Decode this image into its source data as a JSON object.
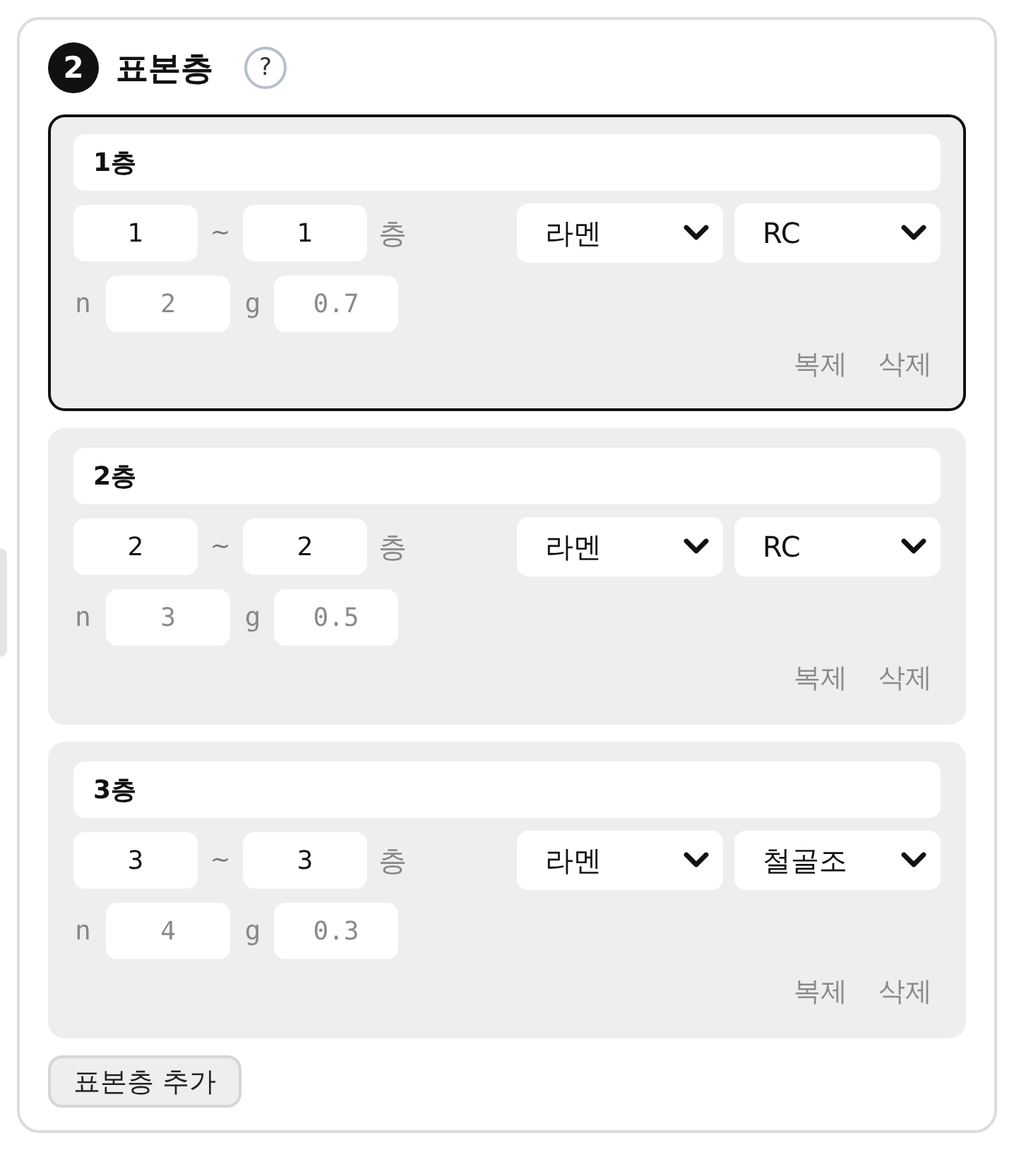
{
  "section": {
    "number": "2",
    "title": "표본층",
    "help": "?"
  },
  "layers": [
    {
      "selected": true,
      "name": "1층",
      "from": "1",
      "tilde": "~",
      "to": "1",
      "unit": "층",
      "frame": "라멘",
      "structure": "RC",
      "n_label": "n",
      "n_placeholder": "2",
      "g_label": "g",
      "g_placeholder": "0.7",
      "actions": [
        "복제",
        "삭제"
      ]
    },
    {
      "selected": false,
      "name": "2층",
      "from": "2",
      "tilde": "~",
      "to": "2",
      "unit": "층",
      "frame": "라멘",
      "structure": "RC",
      "n_label": "n",
      "n_placeholder": "3",
      "g_label": "g",
      "g_placeholder": "0.5",
      "actions": [
        "복제",
        "삭제"
      ]
    },
    {
      "selected": false,
      "name": "3층",
      "from": "3",
      "tilde": "~",
      "to": "3",
      "unit": "층",
      "frame": "라멘",
      "structure": "철골조",
      "n_label": "n",
      "n_placeholder": "4",
      "g_label": "g",
      "g_placeholder": "0.3",
      "actions": [
        "복제",
        "삭제"
      ]
    }
  ],
  "add_button": "표본층 추가"
}
